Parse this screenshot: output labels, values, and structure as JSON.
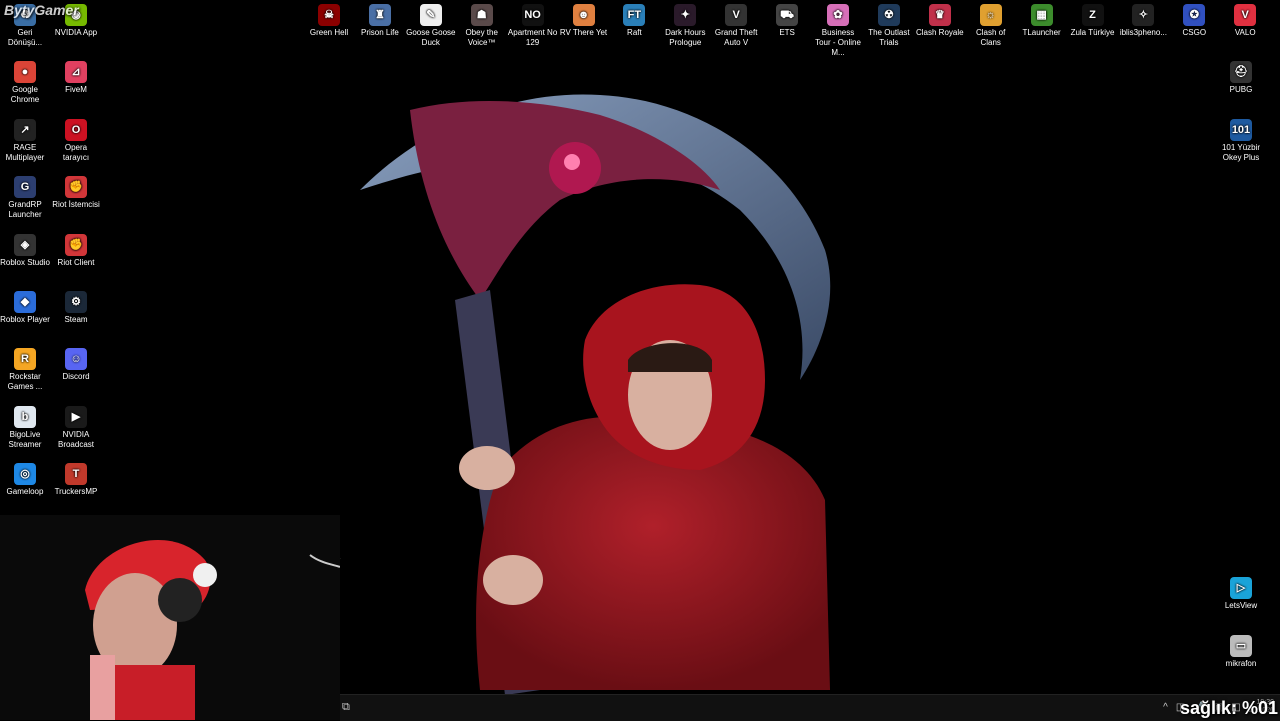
{
  "desktop": {
    "left_icons": [
      {
        "label": "Geri Dönüşü...",
        "icon": "recycle-bin-icon",
        "color": "#3a6ea5",
        "glyph": "♻"
      },
      {
        "label": "NVIDIA App",
        "icon": "nvidia-icon",
        "color": "#76b900",
        "glyph": "◉"
      },
      {
        "label": "Google Chrome",
        "icon": "chrome-icon",
        "color": "#db4437",
        "glyph": "●"
      },
      {
        "label": "FiveM",
        "icon": "fivem-icon",
        "color": "#e04060",
        "glyph": "⊿"
      },
      {
        "label": "RAGE Multiplayer",
        "icon": "rage-icon",
        "color": "#222",
        "glyph": "↗"
      },
      {
        "label": "Opera tarayıcı",
        "icon": "opera-icon",
        "color": "#cc1122",
        "glyph": "O"
      },
      {
        "label": "GrandRP Launcher",
        "icon": "grandrp-icon",
        "color": "#2c3e70",
        "glyph": "G"
      },
      {
        "label": "Riot İstemcisi",
        "icon": "riot-client-icon",
        "color": "#d13639",
        "glyph": "✊"
      },
      {
        "label": "Roblox Studio",
        "icon": "roblox-studio-icon",
        "color": "#333",
        "glyph": "◈"
      },
      {
        "label": "Riot Client",
        "icon": "riot-client-icon",
        "color": "#d13639",
        "glyph": "✊"
      },
      {
        "label": "Roblox Player",
        "icon": "roblox-player-icon",
        "color": "#2b6cd9",
        "glyph": "◆"
      },
      {
        "label": "Steam",
        "icon": "steam-icon",
        "color": "#1b2838",
        "glyph": "⚙"
      },
      {
        "label": "Rockstar Games ...",
        "icon": "rockstar-icon",
        "color": "#f5a623",
        "glyph": "R"
      },
      {
        "label": "Discord",
        "icon": "discord-icon",
        "color": "#5865f2",
        "glyph": "☺"
      },
      {
        "label": "BigoLive Streamer",
        "icon": "bigolive-icon",
        "color": "#e0e8f0",
        "glyph": "b"
      },
      {
        "label": "NVIDIA Broadcast",
        "icon": "nvidia-broadcast-icon",
        "color": "#1a1a1a",
        "glyph": "▶"
      },
      {
        "label": "Gameloop",
        "icon": "gameloop-icon",
        "color": "#1e88e5",
        "glyph": "◎"
      },
      {
        "label": "TruckersMP",
        "icon": "truckersmp-icon",
        "color": "#c0392b",
        "glyph": "T"
      }
    ],
    "top_icons": [
      {
        "label": "Green Hell",
        "icon": "green-hell-icon",
        "color": "#8b0000",
        "glyph": "☠"
      },
      {
        "label": "Prison Life",
        "icon": "prison-life-icon",
        "color": "#4a6fa5",
        "glyph": "♜"
      },
      {
        "label": "Goose Goose Duck",
        "icon": "goose-goose-duck-icon",
        "color": "#eeeeee",
        "glyph": "✎"
      },
      {
        "label": "Obey the Voice™",
        "icon": "obey-the-voice-icon",
        "color": "#5a4a4a",
        "glyph": "☗"
      },
      {
        "label": "Apartment No 129",
        "icon": "apartment-icon",
        "color": "#111",
        "glyph": "NO"
      },
      {
        "label": "RV There Yet",
        "icon": "rv-there-yet-icon",
        "color": "#e08040",
        "glyph": "☻"
      },
      {
        "label": "Raft",
        "icon": "raft-icon",
        "color": "#2a7fb8",
        "glyph": "FT"
      },
      {
        "label": "Dark Hours Prologue",
        "icon": "dark-hours-icon",
        "color": "#2a1a2a",
        "glyph": "✦"
      },
      {
        "label": "Grand Theft Auto V",
        "icon": "gta-v-icon",
        "color": "#333",
        "glyph": "V"
      },
      {
        "label": "ETS",
        "icon": "ets-icon",
        "color": "#444",
        "glyph": "⛟"
      },
      {
        "label": "Business Tour - Online M...",
        "icon": "business-tour-icon",
        "color": "#d66fb8",
        "glyph": "✿"
      },
      {
        "label": "The Outlast Trials",
        "icon": "outlast-trials-icon",
        "color": "#1f3a5a",
        "glyph": "☢"
      },
      {
        "label": "Clash Royale",
        "icon": "clash-royale-icon",
        "color": "#c0304a",
        "glyph": "♛"
      },
      {
        "label": "Clash of Clans",
        "icon": "clash-of-clans-icon",
        "color": "#e0a030",
        "glyph": "☼"
      },
      {
        "label": "TLauncher",
        "icon": "tlauncher-icon",
        "color": "#3c8c2c",
        "glyph": "▦"
      },
      {
        "label": "Zula Türkiye",
        "icon": "zula-icon",
        "color": "#111",
        "glyph": "Z"
      },
      {
        "label": "iblis3pheno...",
        "icon": "iblis-icon",
        "color": "#222",
        "glyph": "✧"
      },
      {
        "label": "CSGO",
        "icon": "csgo-icon",
        "color": "#3050c0",
        "glyph": "✪"
      },
      {
        "label": "VALO",
        "icon": "valorant-icon",
        "color": "#e03040",
        "glyph": "V"
      }
    ],
    "right_icons": [
      {
        "label": "PUBG",
        "icon": "pubg-icon",
        "color": "#333",
        "glyph": "⛑"
      },
      {
        "label": "101 Yüzbir Okey Plus",
        "icon": "okey-plus-icon",
        "color": "#1e5aa0",
        "glyph": "101"
      },
      {
        "label": "LetsView",
        "icon": "letsview-icon",
        "color": "#1aa3d8",
        "glyph": "▷"
      },
      {
        "label": "mikrafon",
        "icon": "microphone-file-icon",
        "color": "#bbbbbb",
        "glyph": "▭"
      }
    ]
  },
  "overlay": {
    "health_text": "sağlık: %01",
    "watermark": "BytyGamer"
  },
  "taskbar": {
    "time": "19:30",
    "date": "2...2026"
  }
}
